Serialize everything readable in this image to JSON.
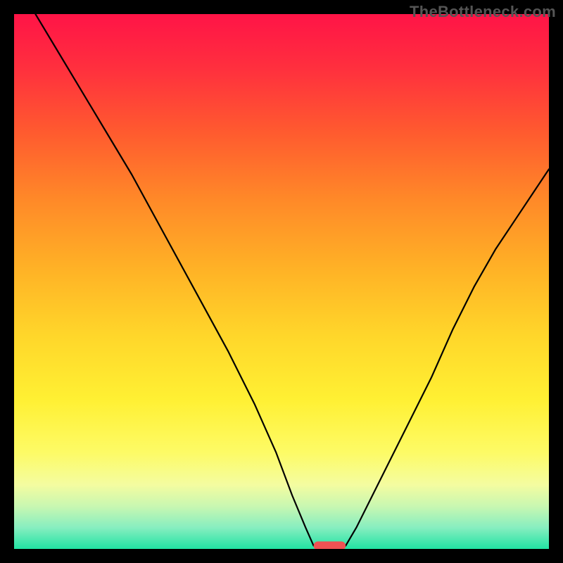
{
  "watermark": "TheBottleneck.com",
  "colors": {
    "background": "#000000",
    "gradient_stops": [
      {
        "offset": 0.0,
        "color": "#ff1447"
      },
      {
        "offset": 0.1,
        "color": "#ff2f3e"
      },
      {
        "offset": 0.22,
        "color": "#ff5a2f"
      },
      {
        "offset": 0.35,
        "color": "#ff8a28"
      },
      {
        "offset": 0.48,
        "color": "#ffb326"
      },
      {
        "offset": 0.6,
        "color": "#ffd62a"
      },
      {
        "offset": 0.72,
        "color": "#fff033"
      },
      {
        "offset": 0.82,
        "color": "#fdfb66"
      },
      {
        "offset": 0.88,
        "color": "#f4fca0"
      },
      {
        "offset": 0.92,
        "color": "#c9f7b1"
      },
      {
        "offset": 0.96,
        "color": "#87eec0"
      },
      {
        "offset": 1.0,
        "color": "#21e3a3"
      }
    ],
    "curve": "#000000",
    "marker": "#ef5253"
  },
  "chart_data": {
    "type": "line",
    "title": "",
    "xlabel": "",
    "ylabel": "",
    "xlim": [
      0,
      100
    ],
    "ylim": [
      0,
      100
    ],
    "grid": false,
    "series": [
      {
        "name": "left-branch",
        "x": [
          4,
          10,
          16,
          22,
          28,
          34,
          40,
          45,
          49,
          52,
          54.5,
          56
        ],
        "y": [
          100,
          90,
          80,
          70,
          59,
          48,
          37,
          27,
          18,
          10,
          4,
          0.6
        ]
      },
      {
        "name": "right-branch",
        "x": [
          62,
          64,
          67,
          70,
          74,
          78,
          82,
          86,
          90,
          94,
          98,
          100
        ],
        "y": [
          0.6,
          4,
          10,
          16,
          24,
          32,
          41,
          49,
          56,
          62,
          68,
          71
        ]
      }
    ],
    "marker": {
      "x_center": 59,
      "y": 0.6,
      "width_pct": 6,
      "height_pct": 1.6
    },
    "notes": "V-shaped bottleneck curve over a vertical red-to-green heat gradient. Values are estimated from pixel positions on a 0–100 normalized axis."
  }
}
